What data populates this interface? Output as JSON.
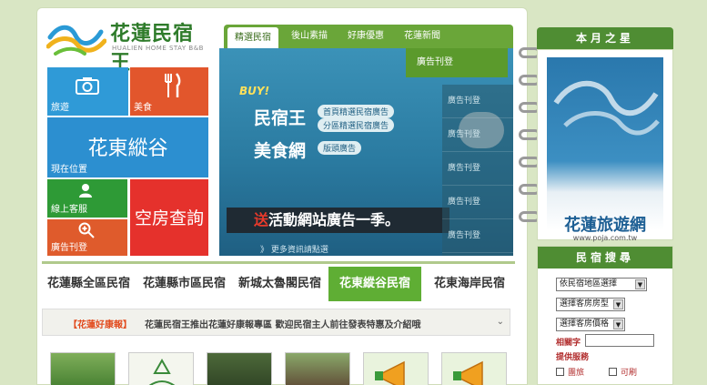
{
  "logo": {
    "title": "花蓮民宿王",
    "subtitle": "HUALIEN HOME STAY B&B"
  },
  "tiles": {
    "travel": "旅遊",
    "food": "美食",
    "valley": "花東縱谷",
    "location": "現在位置",
    "service": "線上客服",
    "ad": "廣告刊登",
    "room": "空房查詢"
  },
  "tabs": [
    "精選民宿",
    "後山素描",
    "好康優惠",
    "花蓮新聞"
  ],
  "banner": {
    "buy": "BUY!",
    "line1": "民宿王",
    "pill1": "首頁精選民宿廣告",
    "pill2": "分區精選民宿廣告",
    "line2": "美食網",
    "pill3": "版頭廣告",
    "promo_red": "送",
    "promo": "活動網站廣告一季。",
    "more": "》 更多資訊請點選",
    "ad_button": "廣告刊登",
    "side_items": [
      "廣告刊登",
      "廣告刊登",
      "廣告刊登",
      "廣告刊登",
      "廣告刊登"
    ]
  },
  "regions": [
    "花蓮縣全區民宿",
    "花蓮縣市區民宿",
    "新城太魯閣民宿",
    "花東縱谷民宿",
    "花東海岸民宿"
  ],
  "ticker": {
    "tag": "【花蓮好康報】",
    "text": "花蓮民宿王推出花蓮好康報專區 歡迎民宿主人前往發表特惠及介紹哦",
    "arrow": "⌄"
  },
  "right": {
    "star_title": "本月之星",
    "star_name": "花蓮旅遊網",
    "star_url": "www.poja.com.tw",
    "search_title": "民宿搜尋",
    "select1": "依民宿地區選擇",
    "select2": "選擇客房房型",
    "select3": "選擇客房價格",
    "keyword": "相關字",
    "service": "提供服務",
    "chk1": "團旅",
    "chk2": "可刷"
  },
  "colors": {
    "brand_green": "#5fae34",
    "tile_blue": "#2c8fd0",
    "tile_red": "#e5312c",
    "tile_orange": "#e2562c"
  }
}
